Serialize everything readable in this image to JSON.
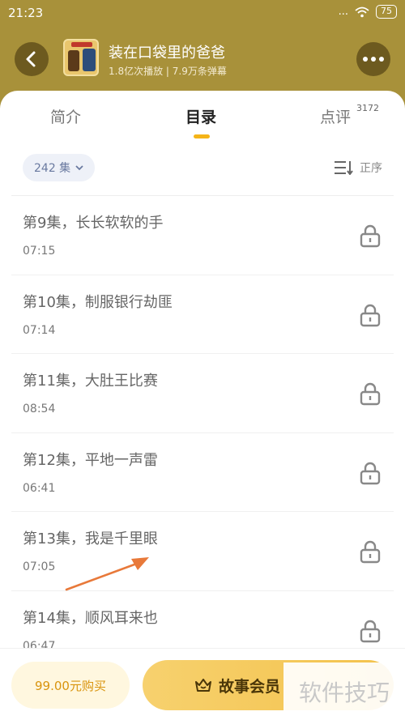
{
  "status_bar": {
    "time": "21:23",
    "signal": "...",
    "battery": "75"
  },
  "header": {
    "title": "装在口袋里的爸爸",
    "subtitle": "1.8亿次播放 | 7.9万条弹幕"
  },
  "tabs": [
    {
      "label": "简介"
    },
    {
      "label": "目录",
      "active": true
    },
    {
      "label": "点评",
      "count": "3172"
    }
  ],
  "filter": {
    "label": "242 集"
  },
  "sort": {
    "label": "正序"
  },
  "episodes": [
    {
      "title": "第9集，长长软软的手",
      "duration": "07:15"
    },
    {
      "title": "第10集，制服银行劫匪",
      "duration": "07:14"
    },
    {
      "title": "第11集，大肚王比赛",
      "duration": "08:54"
    },
    {
      "title": "第12集，平地一声雷",
      "duration": "06:41"
    },
    {
      "title": "第13集，我是千里眼",
      "duration": "07:05"
    },
    {
      "title": "第14集，顺风耳来也",
      "duration": "06:47"
    }
  ],
  "bottom": {
    "buy_label": "99.00元购买",
    "vip_label": "故事会员"
  },
  "watermark": "软件技巧",
  "colors": {
    "header_bg": "#a8913a",
    "accent": "#f5b418",
    "arrow": "#e8793a"
  }
}
